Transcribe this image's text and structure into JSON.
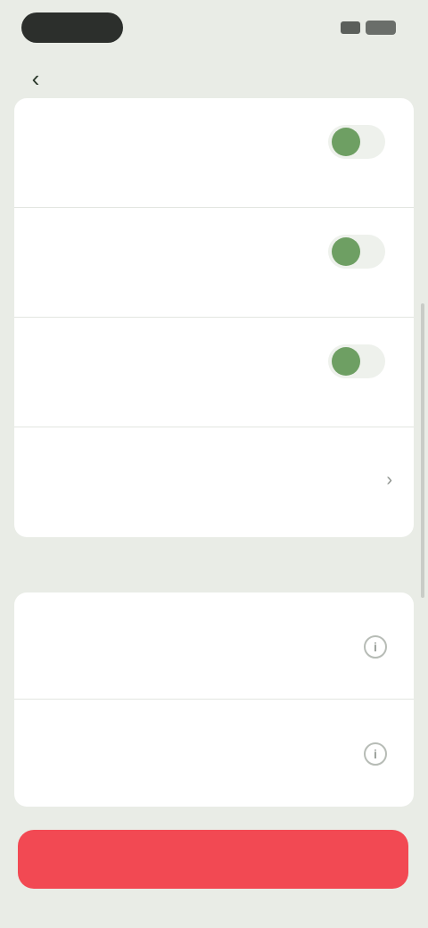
{
  "status_bar": {
    "time": "",
    "icons": [
      "signal-icon",
      "battery-icon"
    ]
  },
  "nav": {
    "back_icon": "chevron-left-icon",
    "title": ""
  },
  "group_1": {
    "rows": [
      {
        "title": "",
        "description": "",
        "control": "toggle",
        "on": true
      },
      {
        "title": "",
        "description": "",
        "control": "toggle",
        "on": true
      },
      {
        "title": "",
        "description": "",
        "control": "toggle",
        "on": true
      },
      {
        "title": "",
        "description": "",
        "control": "value-chevron",
        "value": ""
      }
    ]
  },
  "section_2": {
    "label": "",
    "rows": [
      {
        "title": "",
        "description": "",
        "control": "info"
      },
      {
        "title": "",
        "description": "",
        "control": "info"
      }
    ]
  },
  "action": {
    "label": ""
  },
  "colors": {
    "background": "#e9ece6",
    "card": "#ffffff",
    "toggle_on": "#6e9f63",
    "danger": "#f24953"
  }
}
